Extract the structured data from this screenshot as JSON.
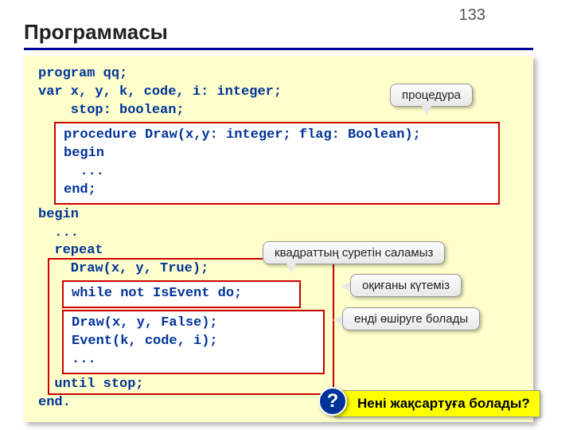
{
  "page_number": "133",
  "title": "Программасы",
  "code": {
    "l1": "program qq;",
    "l2": "var x, y, k, code, i: integer;",
    "l3": "    stop: boolean;",
    "proc1": "procedure Draw(x,y: integer; flag: Boolean);",
    "proc2": "begin",
    "proc3": "  ...",
    "proc4": "end;",
    "l4": "begin",
    "l5": "  ...",
    "l6": "  repeat",
    "l7": "    Draw(x, y, True);",
    "while_line": "while not IsEvent do;",
    "draw2_l1": "Draw(x, y, False);",
    "draw2_l2": "Event(k, code, i);",
    "draw2_l3": "...",
    "l8": "  until stop;",
    "l9": "end."
  },
  "callouts": {
    "procedure": "процедура",
    "square": "квадраттың суретін саламыз",
    "event": "оқиғаны күтеміз",
    "erase": "енді өшіруге болады"
  },
  "question": {
    "mark": "?",
    "text": "Нені жақсартуға болады?"
  }
}
